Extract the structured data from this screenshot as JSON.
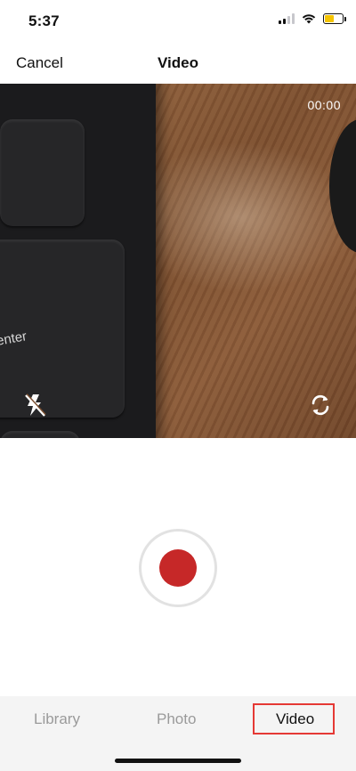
{
  "status_bar": {
    "time": "5:37",
    "signal_bars_on": 2,
    "signal_bars_total": 4,
    "battery_level": 0.55,
    "battery_color": "#f5c400",
    "icons": [
      "cellular-signal-icon",
      "wifi-icon",
      "battery-icon"
    ]
  },
  "nav": {
    "cancel_label": "Cancel",
    "title": "Video"
  },
  "preview": {
    "timer": "00:00",
    "keyboard_key_text": "enter",
    "flash_icon": "flash-off-icon",
    "switch_camera_icon": "switch-camera-icon"
  },
  "record": {
    "icon": "record-icon",
    "dot_color": "#c62828",
    "ring_color": "#e2e2e2"
  },
  "tabs": {
    "items": [
      {
        "label": "Library",
        "active": false
      },
      {
        "label": "Photo",
        "active": false
      },
      {
        "label": "Video",
        "active": true
      }
    ],
    "highlight_color": "#e53935"
  }
}
